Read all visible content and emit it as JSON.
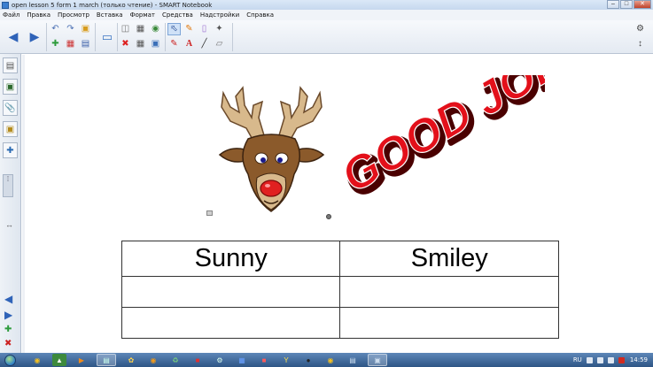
{
  "window": {
    "title": "open lesson 5 form 1 march (только чтение) - SMART Notebook",
    "controls": {
      "minimize": "–",
      "maximize": "□",
      "close": "✕"
    }
  },
  "menu": {
    "items": [
      "Файл",
      "Правка",
      "Просмотр",
      "Вставка",
      "Формат",
      "Средства",
      "Надстройки",
      "Справка"
    ]
  },
  "toolbar": {
    "icons": [
      "back-arrow-icon",
      "forward-arrow-icon",
      "undo-icon",
      "redo-icon",
      "open-file-icon",
      "add-page-icon",
      "delete-page-icon",
      "save-icon",
      "screen-shade-icon",
      "paste-icon",
      "delete-icon",
      "table-icon",
      "capture-icon",
      "fullscreen-icon",
      "select-icon",
      "pen-icon",
      "eraser-icon",
      "creative-pen-icon",
      "magic-pen-icon",
      "text-icon",
      "line-icon",
      "fill-icon",
      "properties-gear-icon",
      "move-toolbar-icon"
    ]
  },
  "sidebar": {
    "tabs": [
      "page-sorter-icon",
      "gallery-icon",
      "attachments-icon",
      "properties-icon",
      "addons-icon"
    ],
    "handle_label": "⁞",
    "resize_label": "↔"
  },
  "content": {
    "banner_text": "GOOD JOB!",
    "table": {
      "rows": [
        [
          "Sunny",
          "Smiley"
        ],
        [
          "",
          ""
        ],
        [
          "",
          ""
        ]
      ]
    }
  },
  "taskbar": {
    "apps": [
      "chrome-icon",
      "gvim-icon",
      "media-icon",
      "smart-notebook-icon",
      "paint-icon",
      "firefox-icon",
      "recycle-icon",
      "acrobat-icon",
      "gear-icon",
      "word-icon",
      "yandex-icon",
      "y-icon",
      "media-player-icon",
      "explorer-icon",
      "word-doc-icon",
      "notebook-icon"
    ],
    "language": "RU",
    "clock": "14:59"
  },
  "colors": {
    "banner_red": "#e3101a",
    "antler": "#d8b98c",
    "fur": "#8b5a2b",
    "nose": "#e02020"
  }
}
